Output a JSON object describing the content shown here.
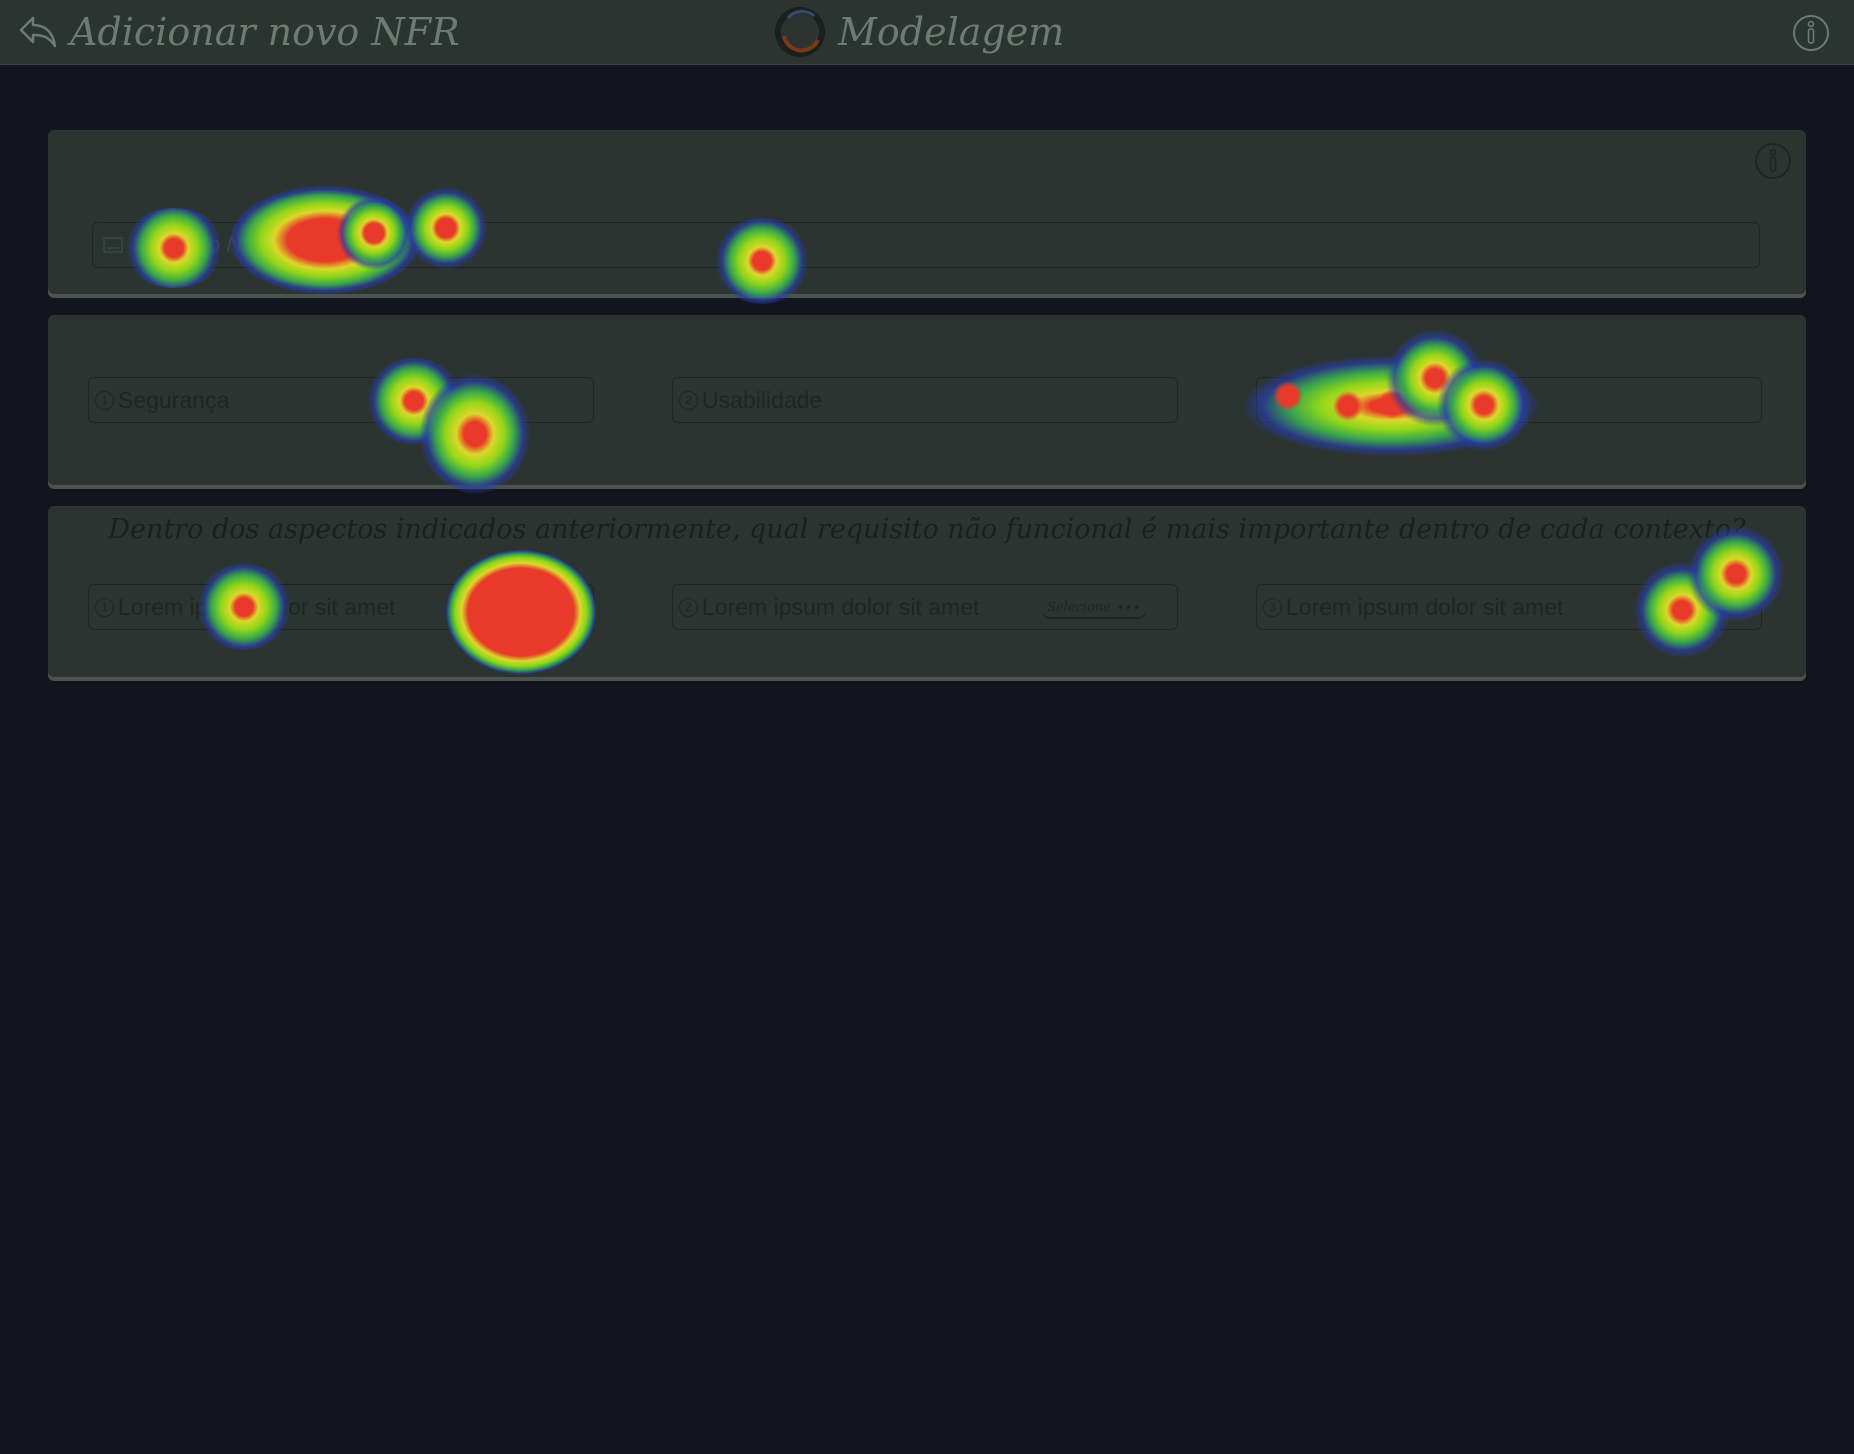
{
  "header": {
    "title": "Adicionar novo NFR",
    "app_name": "Modelagem",
    "back_icon": "back-arrow-icon",
    "info_icon": "info-icon"
  },
  "name_card": {
    "placeholder": "Nome do NFR",
    "info_icon": "info-icon"
  },
  "aspects": [
    {
      "number": "1",
      "label": "Segurança"
    },
    {
      "number": "2",
      "label": "Usabilidade"
    },
    {
      "number": "3",
      "label": ""
    }
  ],
  "question_card": {
    "question": "Dentro dos aspectos indicados anteriormente, qual requisito não funcional é mais importante dentro de cada contexto?",
    "fields": [
      {
        "number": "1",
        "label": "Lorem ipsum dolor sit amet",
        "select": ""
      },
      {
        "number": "2",
        "label": "Lorem ipsum dolor sit amet",
        "select": "Selecione"
      },
      {
        "number": "3",
        "label": "Lorem ipsum dolor sit amet",
        "select": ""
      }
    ]
  },
  "colors": {
    "background": "#12141e",
    "surface": "#2b3430",
    "muted_text": "#6f7a73",
    "heat_hot": "#e8392a",
    "heat_mid": "#9ad81a",
    "heat_cold": "#1c2a9a"
  }
}
